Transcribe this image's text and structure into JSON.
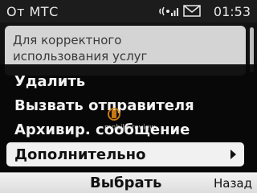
{
  "status_bar": {
    "title": "От МТС",
    "time": "01:53",
    "icons": [
      "signal-icon",
      "mail-icon"
    ]
  },
  "message": {
    "preview_line_1": "Для корректного",
    "preview_line_2": "использования услуг"
  },
  "menu": {
    "items": [
      {
        "label": "Удалить"
      },
      {
        "label": "Вызвать отправителя"
      },
      {
        "label": "Архивир. сообщение"
      },
      {
        "label": "Дополнительно",
        "selected": true,
        "has_submenu": true
      }
    ]
  },
  "watermark": {
    "text": "mobile-review"
  },
  "softkeys": {
    "select": "Выбрать",
    "back": "Назад"
  },
  "colors": {
    "selected_bg": "#f1f1f1",
    "menu_bg": "#080808",
    "text_light": "#f2f2f2"
  }
}
